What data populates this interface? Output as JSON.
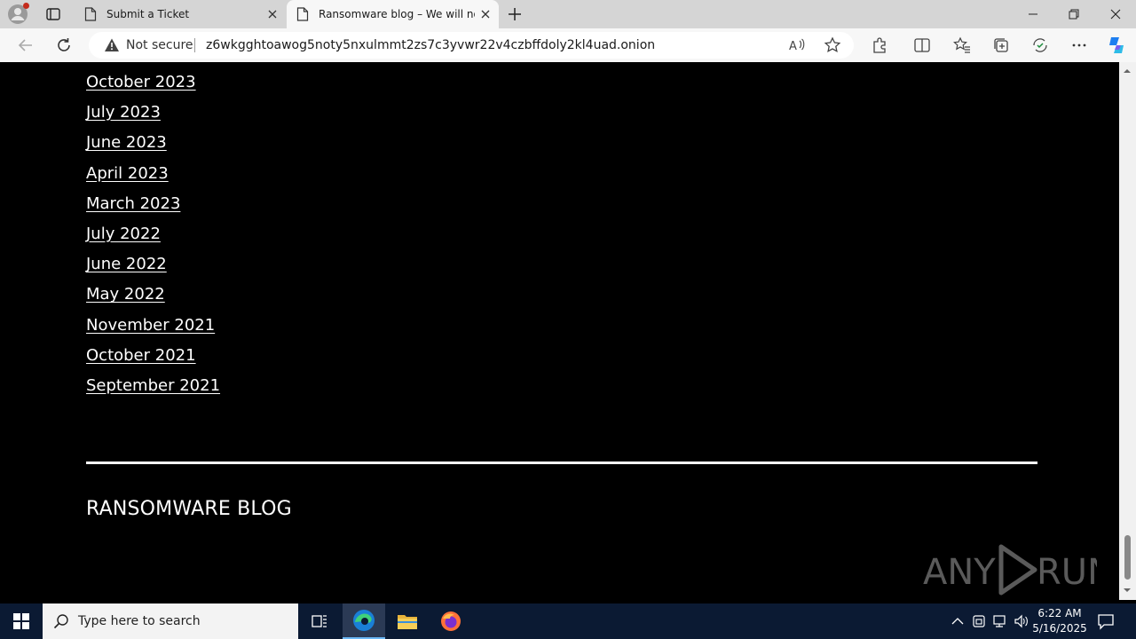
{
  "browser": {
    "tabs": [
      {
        "label": "Submit a Ticket"
      },
      {
        "label": "Ransomware blog – We will not g"
      }
    ],
    "address": {
      "security_label": "Not secure",
      "url": "z6wkgghtoawog5noty5nxulmmt2zs7c3yvwr22v4czbffdoly2kl4uad.onion"
    }
  },
  "page": {
    "archive_links": [
      "October 2023",
      "July 2023",
      "June 2023",
      "April 2023",
      "March 2023",
      "July 2022",
      "June 2022",
      "May 2022",
      "November 2021",
      "October 2021",
      "September 2021"
    ],
    "site_title": "RANSOMWARE BLOG",
    "watermark": "ANY RUN"
  },
  "taskbar": {
    "search_placeholder": "Type here to search",
    "time": "6:22 AM",
    "date": "5/16/2025"
  }
}
